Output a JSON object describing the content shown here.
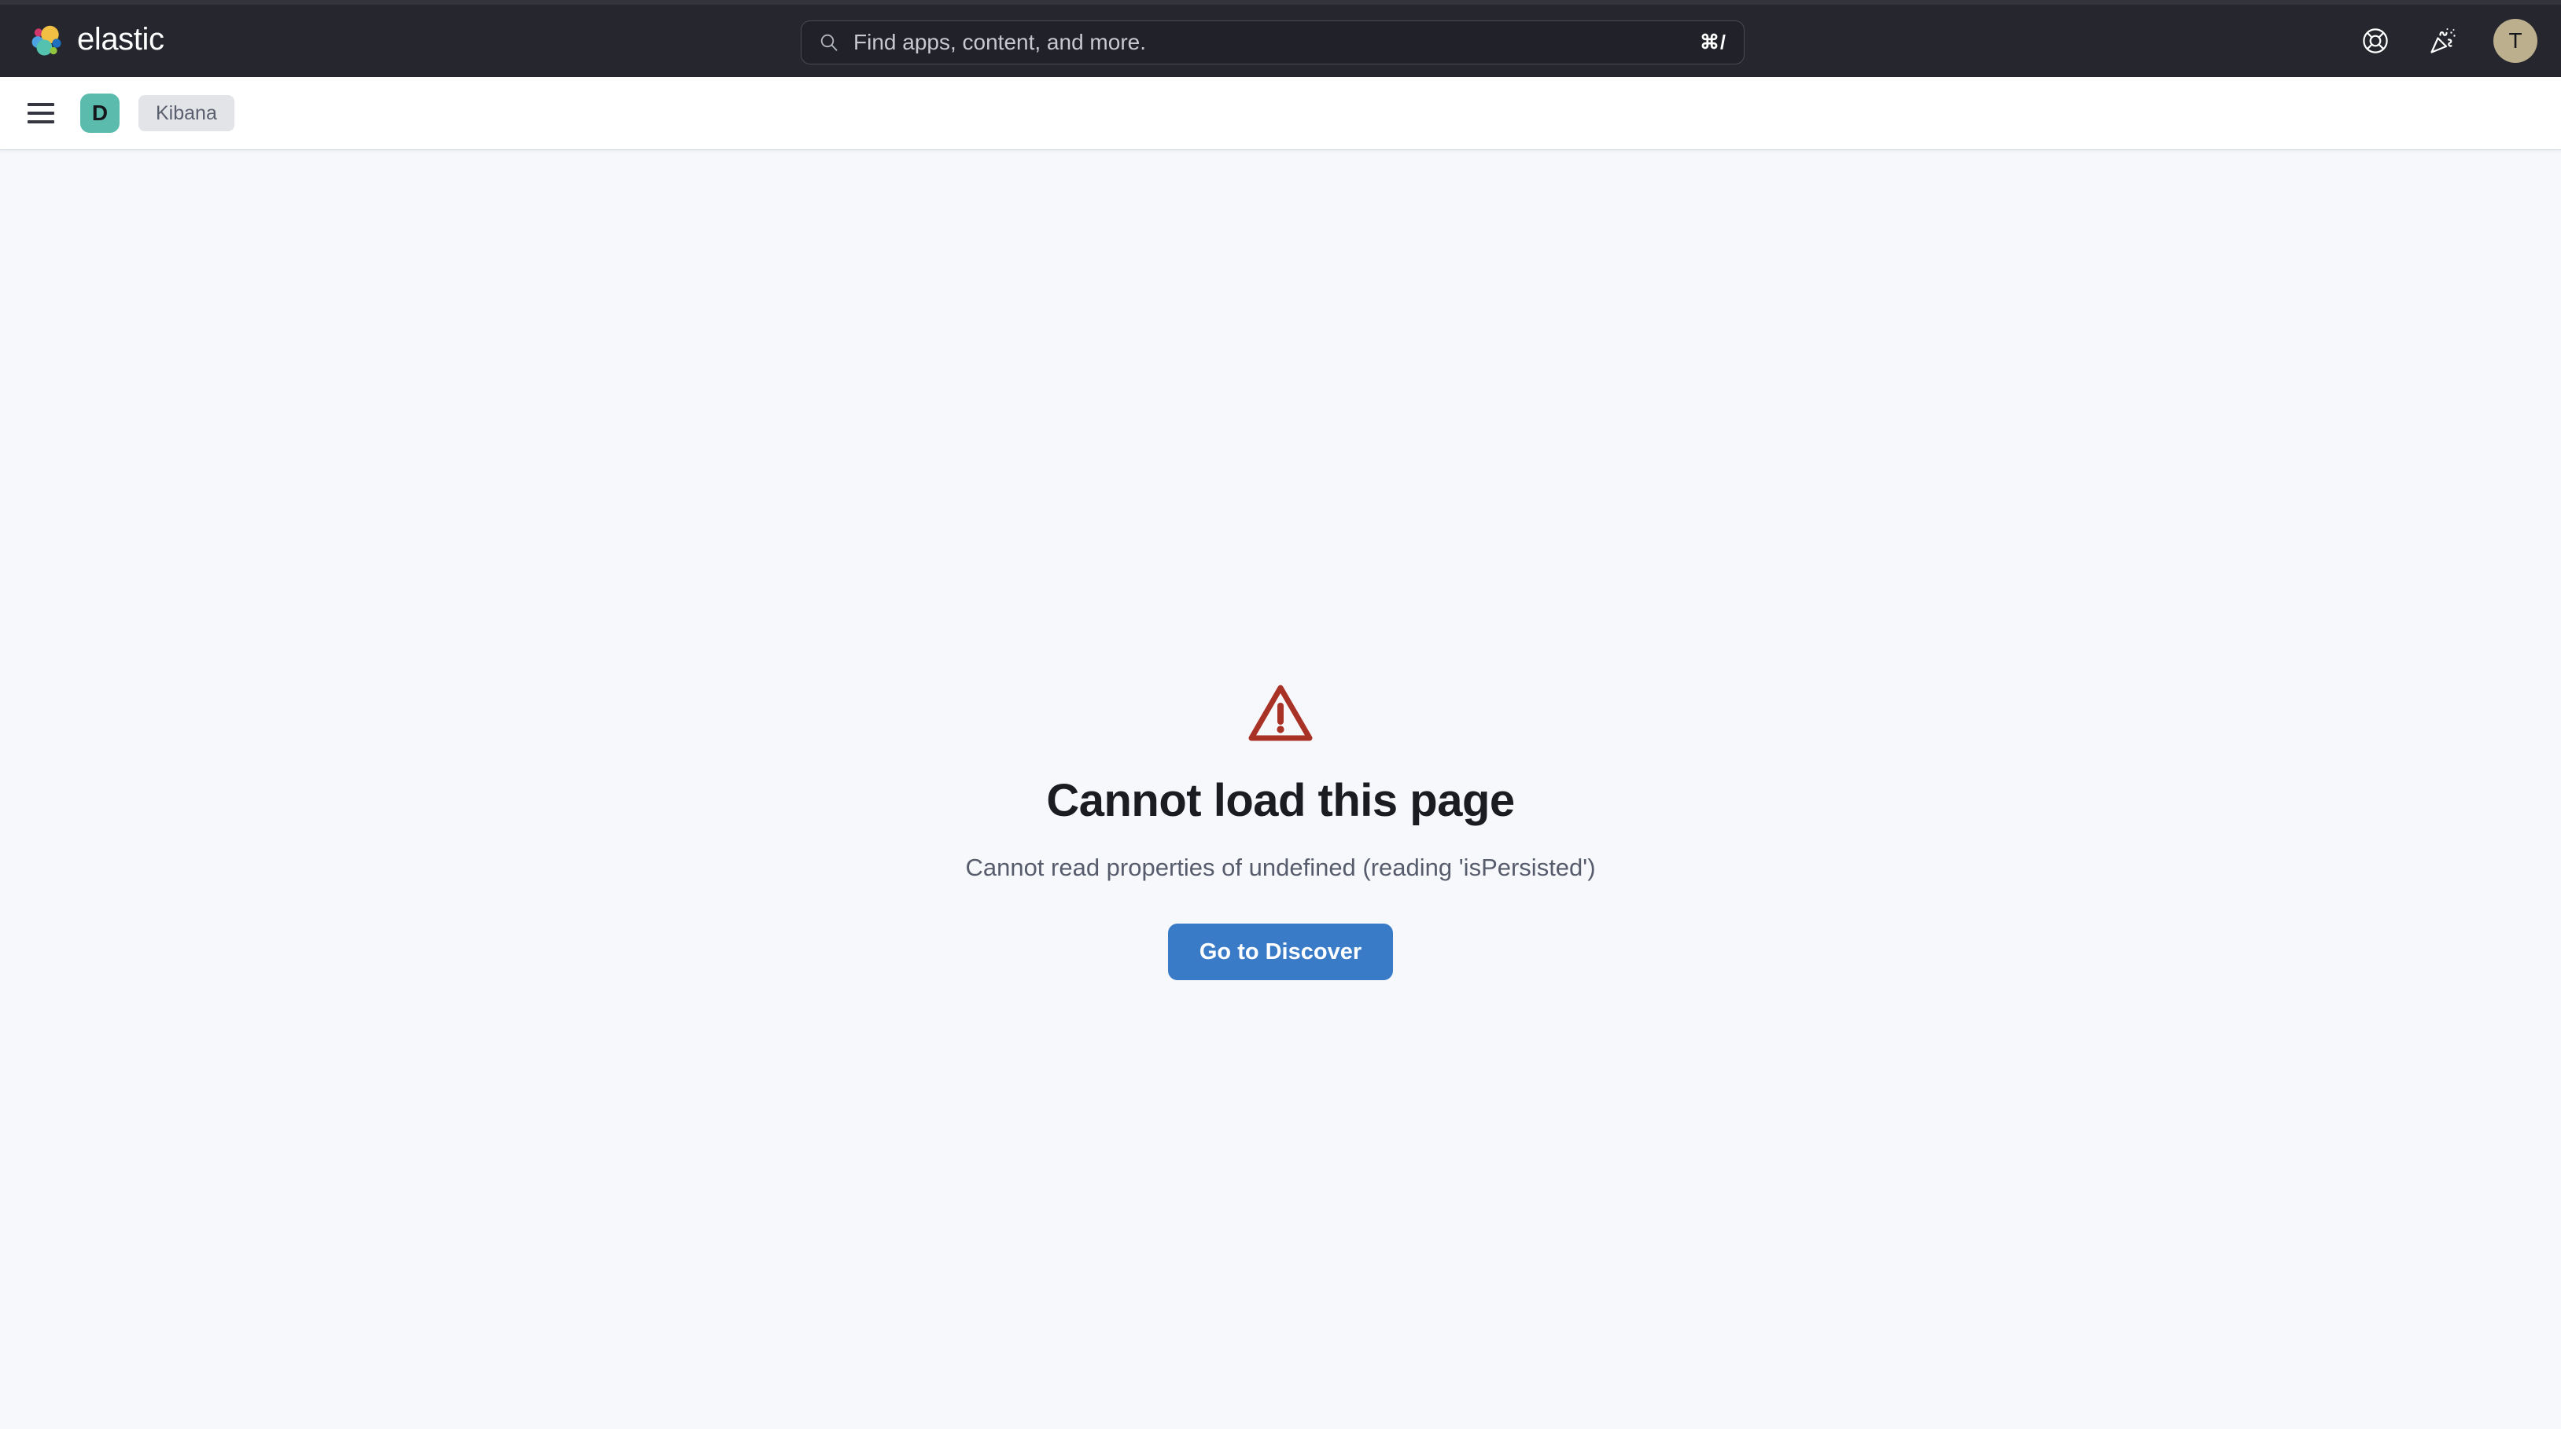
{
  "header": {
    "brand_name": "elastic",
    "brand_logo_icon": "elastic-logo-icon",
    "search": {
      "placeholder": "Find apps, content, and more.",
      "value": "",
      "icon": "search-icon",
      "shortcut": "⌘/"
    },
    "actions": [
      {
        "name": "help-menu-button",
        "icon": "help-life-ring-icon"
      },
      {
        "name": "news-feed-button",
        "icon": "party-popper-icon"
      }
    ],
    "avatar": {
      "initial": "T",
      "color": "#BCAF8E"
    }
  },
  "breadcrumb_bar": {
    "menu_button_icon": "hamburger-menu-icon",
    "app_badge": {
      "letter": "D",
      "color": "#5BBCAD"
    },
    "crumbs": [
      {
        "label": "Kibana"
      }
    ]
  },
  "main": {
    "error": {
      "icon": "warning-triangle-icon",
      "icon_color": "#A93226",
      "title": "Cannot load this page",
      "message": "Cannot read properties of undefined (reading 'isPersisted')",
      "action_label": "Go to Discover",
      "action_color": "#3A7BC8"
    }
  },
  "theme": {
    "header_bg": "#25262E",
    "page_bg": "#F7F8FC",
    "bar_bg": "#FFFFFF",
    "accent": "#3A7BC8"
  }
}
